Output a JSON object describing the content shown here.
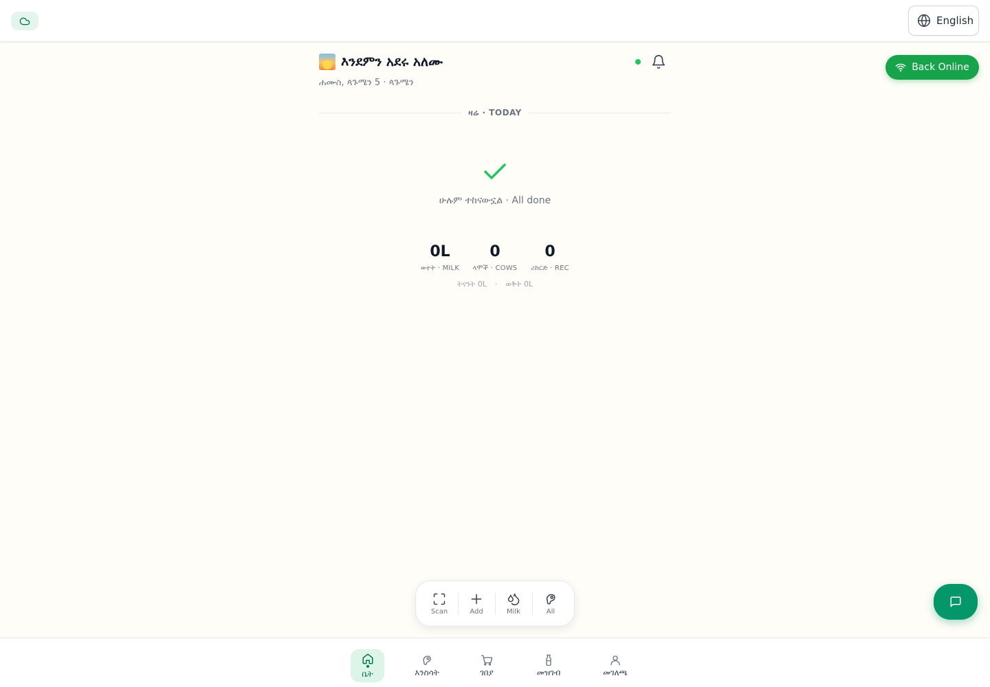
{
  "topbar": {
    "cloud_icon": "cloud-icon",
    "language_label": "English"
  },
  "status": {
    "back_online_label": "Back Online"
  },
  "header": {
    "greeting": "እንደምን አደሩ አለሙ",
    "date": "ሐሙስ, ጳጉሜን 5 · ጳጉሜን"
  },
  "section": {
    "today_label": "ዛሬ · TODAY"
  },
  "summary": {
    "done_text": "ሁሉም ተከናውኗል · All done",
    "stats": [
      {
        "value": "0L",
        "label": "ወተት · MILK"
      },
      {
        "value": "0",
        "label": "ላሞች · COWS"
      },
      {
        "value": "0",
        "label": "ሪከርድ · REC"
      }
    ],
    "yesterday": "ትናንት 0L",
    "evening": "ወቅት 0L"
  },
  "quick_actions": [
    {
      "label": "Scan",
      "icon": "scan-icon"
    },
    {
      "label": "Add",
      "icon": "plus-icon"
    },
    {
      "label": "Milk",
      "icon": "milk-drop-icon"
    },
    {
      "label": "All",
      "icon": "cow-icon"
    }
  ],
  "bottom_nav": [
    {
      "label": "ቤት",
      "icon": "home-icon",
      "active": true
    },
    {
      "label": "እንስሳት",
      "icon": "cow-icon"
    },
    {
      "label": "ገበያ",
      "icon": "cart-icon"
    },
    {
      "label": "መዝገብ",
      "icon": "milk-bottle-icon"
    },
    {
      "label": "መገለጫ",
      "icon": "user-icon"
    }
  ],
  "colors": {
    "accent": "#16a34a",
    "fab": "#059669",
    "background": "#fefdf8",
    "online_dot": "#22c55e"
  }
}
